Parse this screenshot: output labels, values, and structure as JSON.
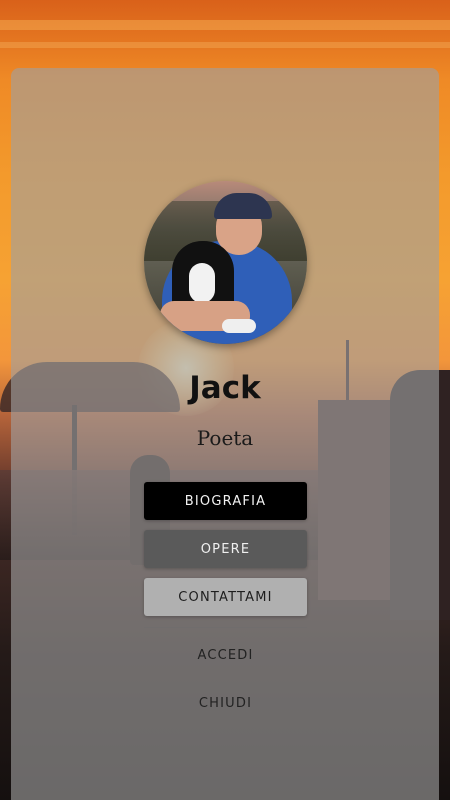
{
  "profile": {
    "name": "Jack",
    "role": "Poeta",
    "avatar_icon": "profile-photo-man-with-dog"
  },
  "menu": {
    "biografia": "BIOGRAFIA",
    "opere": "OPERE",
    "contattami": "CONTATTAMI"
  },
  "secondary": {
    "accedi": "ACCEDI",
    "chiudi": "CHIUDI"
  },
  "colors": {
    "card_overlay": "#a0a0a0",
    "button_primary": "#000000",
    "button_secondary": "#5a5a5a",
    "button_tertiary": "#b0b0b0",
    "sunset_orange": "#f39a2c"
  }
}
